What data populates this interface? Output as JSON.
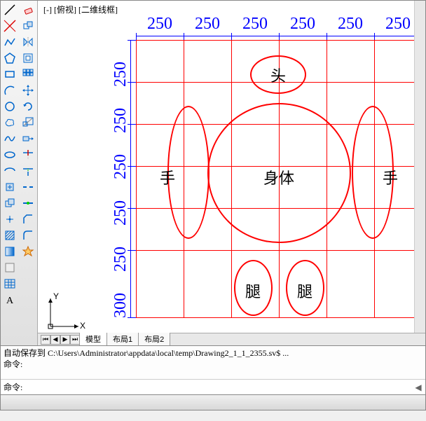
{
  "view_label": "[-] [俯视] [二维线框]",
  "dims_top": [
    "250",
    "250",
    "250",
    "250",
    "250",
    "250"
  ],
  "dims_left": [
    "250",
    "250",
    "250",
    "250",
    "250",
    "300"
  ],
  "labels": {
    "head": "头",
    "body": "身体",
    "hand": "手",
    "leg": "腿"
  },
  "tabs": {
    "model": "模型",
    "layout1": "布局1",
    "layout2": "布局2"
  },
  "cmd": {
    "line1": "自动保存到 C:\\Users\\Administrator\\appdata\\local\\temp\\Drawing2_1_1_2355.sv$ ...",
    "line2": "命令:",
    "prompt": "命令:"
  },
  "ucs": {
    "x": "X",
    "y": "Y"
  },
  "tool_icons": {
    "line": "line-icon",
    "pline": "polyline-icon",
    "circle": "circle-icon",
    "arc": "arc-icon",
    "rect": "rectangle-icon",
    "ellipse": "ellipse-icon",
    "hatch": "hatch-icon",
    "point": "point-icon",
    "text": "text-icon",
    "table": "table-icon",
    "region": "region-icon",
    "spline": "spline-icon",
    "ray": "ray-icon",
    "xline": "xline-icon",
    "move": "move-icon",
    "copy": "copy-icon",
    "rotate": "rotate-icon",
    "mirror": "mirror-icon",
    "scale": "scale-icon",
    "stretch": "stretch-icon",
    "trim": "trim-icon",
    "extend": "extend-icon",
    "fillet": "fillet-icon",
    "explode": "explode-icon",
    "offset": "offset-icon",
    "array": "array-icon",
    "erase": "erase-icon",
    "join": "join-icon"
  }
}
